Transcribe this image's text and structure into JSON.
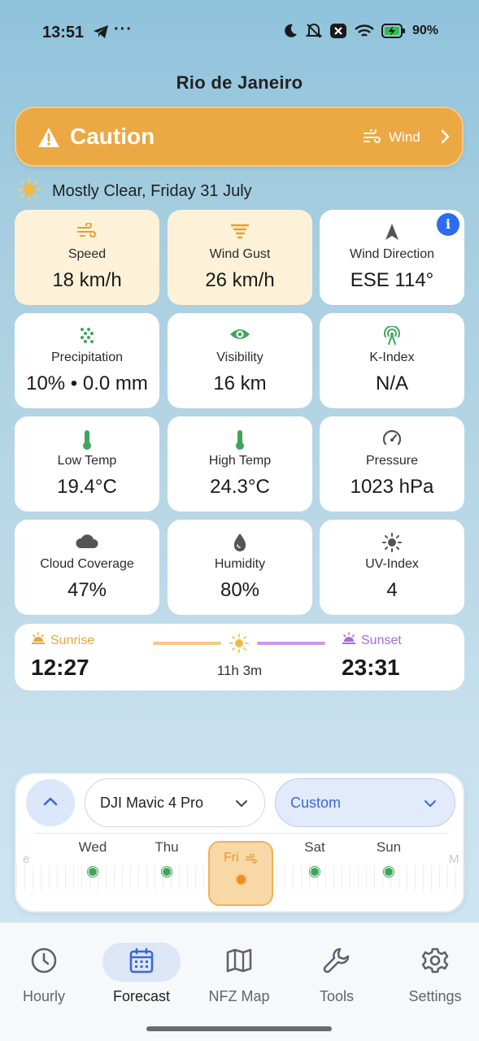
{
  "status_bar": {
    "time": "13:51",
    "dots": "···",
    "battery": "90%"
  },
  "header": {
    "city": "Rio de Janeiro"
  },
  "caution": {
    "title": "Caution",
    "reason": "Wind",
    "color": "#eca843"
  },
  "condition": {
    "text": "Mostly Clear, Friday 31 July"
  },
  "metrics": [
    {
      "label": "Speed",
      "value": "18 km/h",
      "icon": "wind-icon"
    },
    {
      "label": "Wind Gust",
      "value": "26 km/h",
      "icon": "tornado-icon"
    },
    {
      "label": "Wind Direction",
      "value": "ESE 114°",
      "icon": "navigation-arrow-icon",
      "info": "i"
    },
    {
      "label": "Precipitation",
      "value": "10% • 0.0 mm",
      "icon": "rain-dots-icon"
    },
    {
      "label": "Visibility",
      "value": "16 km",
      "icon": "eye-icon"
    },
    {
      "label": "K-Index",
      "value": "N/A",
      "icon": "signal-tower-icon"
    },
    {
      "label": "Low Temp",
      "value": "19.4°C",
      "icon": "thermometer-low-icon"
    },
    {
      "label": "High Temp",
      "value": "24.3°C",
      "icon": "thermometer-high-icon"
    },
    {
      "label": "Pressure",
      "value": "1023 hPa",
      "icon": "gauge-icon"
    },
    {
      "label": "Cloud Coverage",
      "value": "47%",
      "icon": "cloud-icon"
    },
    {
      "label": "Humidity",
      "value": "80%",
      "icon": "droplet-icon"
    },
    {
      "label": "UV-Index",
      "value": "4",
      "icon": "sun-icon"
    }
  ],
  "sun": {
    "sunrise_label": "Sunrise",
    "sunrise_time": "12:27",
    "sunset_label": "Sunset",
    "sunset_time": "23:31",
    "duration": "11h 3m"
  },
  "panel": {
    "drone": "DJI Mavic 4 Pro",
    "profile": "Custom",
    "days": [
      {
        "name": "Wed"
      },
      {
        "name": "Thu"
      },
      {
        "name": "Fri",
        "selected": true
      },
      {
        "name": "Sat"
      },
      {
        "name": "Sun"
      }
    ],
    "edge_left": "e",
    "edge_right": "M"
  },
  "nav": {
    "items": [
      {
        "label": "Hourly",
        "icon": "clock-icon"
      },
      {
        "label": "Forecast",
        "icon": "calendar-icon",
        "active": true
      },
      {
        "label": "NFZ Map",
        "icon": "map-icon"
      },
      {
        "label": "Tools",
        "icon": "wrench-icon"
      },
      {
        "label": "Settings",
        "icon": "gear-icon"
      }
    ]
  },
  "colors": {
    "warning_bg": "#fdf2d7",
    "accent_blue": "#3b67d6",
    "safe_green": "#3fa55b"
  }
}
